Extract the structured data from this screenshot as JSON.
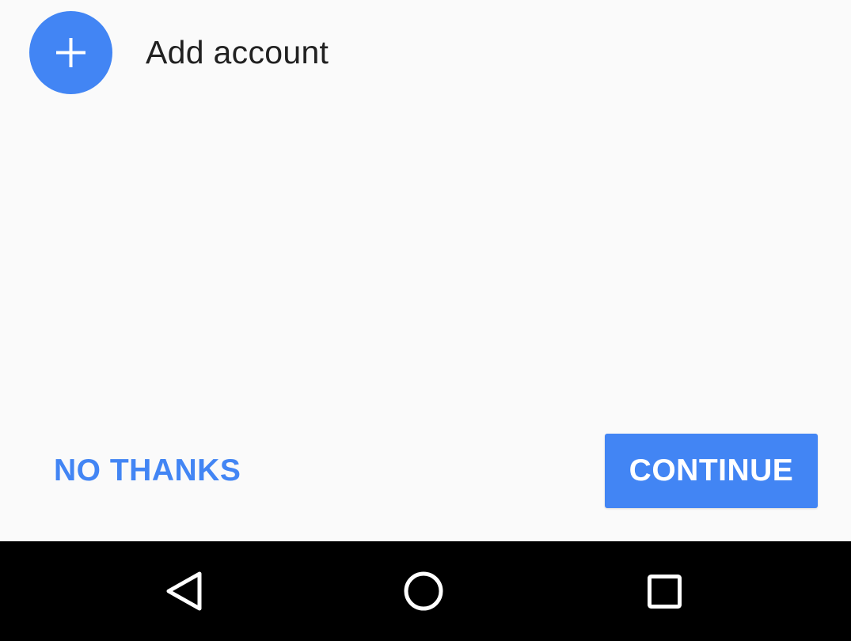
{
  "account": {
    "add_label": "Add account",
    "add_icon": "plus-icon",
    "accent_color": "#4285f4"
  },
  "actions": {
    "no_thanks_label": "NO THANKS",
    "continue_label": "CONTINUE"
  },
  "navbar": {
    "back_icon": "back-triangle-icon",
    "home_icon": "home-circle-icon",
    "recents_icon": "recents-square-icon"
  }
}
